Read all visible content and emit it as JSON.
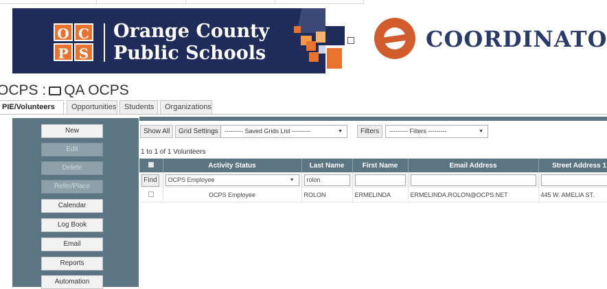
{
  "header": {
    "school_logo_letters": [
      "O",
      "C",
      "P",
      "S"
    ],
    "school_name_line1": "Orange County",
    "school_name_line2": "Public Schools",
    "coordinator_text": "COORDINATOR"
  },
  "page": {
    "breadcrumb_root": "OCPS :",
    "breadcrumb_folder": "QA OCPS"
  },
  "tabs": [
    {
      "label": "PIE/Volunteers",
      "active": true
    },
    {
      "label": "Opportunities"
    },
    {
      "label": "Students"
    },
    {
      "label": "Organizations"
    }
  ],
  "sidebar": {
    "items": [
      {
        "label": "New",
        "enabled": true
      },
      {
        "label": "Edit",
        "enabled": false
      },
      {
        "label": "Delete",
        "enabled": false
      },
      {
        "label": "Refer/Place",
        "enabled": false
      },
      {
        "label": "Calendar",
        "enabled": true
      },
      {
        "label": "Log Book",
        "enabled": true
      },
      {
        "label": "Email",
        "enabled": true
      },
      {
        "label": "Reports",
        "enabled": true
      },
      {
        "label": "Automation",
        "enabled": true
      }
    ]
  },
  "toolbar": {
    "show_all": "Show All",
    "grid_settings": "Grid Settings",
    "saved_grids": "--------- Saved Grids List ---------",
    "filters_button": "Filters",
    "filters_select": "--------- Filters ---------"
  },
  "grid": {
    "count_text": "1 to 1 of 1 Volunteers",
    "columns": [
      "Activity Status",
      "Last Name",
      "First Name",
      "Email Address",
      "Street Address 1"
    ],
    "filter_row": {
      "find_label": "Find",
      "activity_status": "OCPS Employee",
      "last_name": "rolon",
      "first_name": "",
      "email": "",
      "street": ""
    },
    "rows": [
      {
        "activity_status": "OCPS Employee",
        "last_name": "ROLON",
        "first_name": "ERMELINDA",
        "email": "ERMELINDA.ROLON@OCPS.NET",
        "street": "445 W. AMELIA ST."
      }
    ]
  },
  "colors": {
    "banner_navy": "#1f2c5a",
    "brand_orange": "#e9722e",
    "panel_slate": "#5c7583"
  }
}
